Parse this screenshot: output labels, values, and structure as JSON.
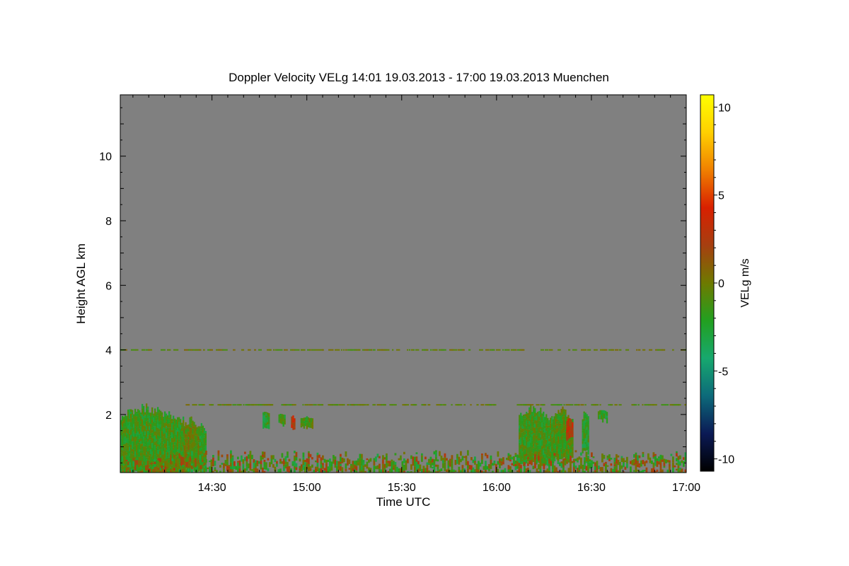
{
  "chart_data": {
    "type": "heatmap",
    "title": "Doppler Velocity VELg   14:01 19.03.2013 - 17:00 19.03.2013 Muenchen",
    "xlabel": "Time UTC",
    "ylabel": "Height AGL km",
    "x_range": [
      "14:01",
      "17:00"
    ],
    "xlim": [
      "14:01",
      "17:00"
    ],
    "x_ticks": [
      "14:30",
      "15:00",
      "15:30",
      "16:00",
      "16:30",
      "17:00"
    ],
    "ylim": [
      0.2,
      11.9
    ],
    "y_ticks": [
      2,
      4,
      6,
      8,
      10
    ],
    "colorbar": {
      "label": "VELg m/s",
      "range": [
        -10.7,
        10.7
      ],
      "ticks": [
        -10,
        -5,
        0,
        5,
        10
      ],
      "colors": [
        "#000000",
        "#0b1a55",
        "#0d6a7a",
        "#17a86e",
        "#22a020",
        "#6e7a00",
        "#a63f10",
        "#d92000",
        "#f08000",
        "#ffd000",
        "#ffff00"
      ]
    },
    "background_color": "#808080",
    "echo_regions": [
      {
        "start": "14:01",
        "end": "14:21",
        "top_km": 2.35,
        "bottom_km": 0.25,
        "mean_velocity_ms": -1.5
      },
      {
        "start": "14:21",
        "end": "14:26",
        "top_km": 1.95,
        "bottom_km": 0.35,
        "mean_velocity_ms": -0.5
      },
      {
        "start": "14:26",
        "end": "14:28",
        "top_km": 1.8,
        "bottom_km": 0.3,
        "mean_velocity_ms": -2.0
      },
      {
        "start": "14:46",
        "end": "14:48",
        "top_km": 2.15,
        "bottom_km": 1.65,
        "mean_velocity_ms": -2.0
      },
      {
        "start": "14:51",
        "end": "14:53",
        "top_km": 2.05,
        "bottom_km": 1.75,
        "mean_velocity_ms": -1.5
      },
      {
        "start": "14:55",
        "end": "14:56",
        "top_km": 2.0,
        "bottom_km": 1.6,
        "mean_velocity_ms": 3.0
      },
      {
        "start": "14:58",
        "end": "15:02",
        "top_km": 1.95,
        "bottom_km": 1.65,
        "mean_velocity_ms": -1.0
      },
      {
        "start": "16:07",
        "end": "16:18",
        "top_km": 2.3,
        "bottom_km": 0.55,
        "mean_velocity_ms": -1.5
      },
      {
        "start": "16:18",
        "end": "16:24",
        "top_km": 2.25,
        "bottom_km": 0.7,
        "mean_velocity_ms": -1.0
      },
      {
        "start": "16:22",
        "end": "16:24",
        "top_km": 1.9,
        "bottom_km": 1.3,
        "mean_velocity_ms": 3.0
      },
      {
        "start": "16:27",
        "end": "16:29",
        "top_km": 2.2,
        "bottom_km": 0.9,
        "mean_velocity_ms": -2.0
      },
      {
        "start": "16:32",
        "end": "16:35",
        "top_km": 2.15,
        "bottom_km": 1.9,
        "mean_velocity_ms": -2.0
      },
      {
        "start": "14:01",
        "end": "17:00",
        "top_km": 0.9,
        "bottom_km": 0.2,
        "mean_velocity_ms": -0.3
      }
    ],
    "layers": [
      {
        "height_km": 2.3,
        "start": "14:21",
        "end": "17:00",
        "velocity_ms": -0.5
      },
      {
        "height_km": 4.0,
        "start": "14:01",
        "end": "17:00",
        "velocity_ms": -0.3
      }
    ]
  }
}
